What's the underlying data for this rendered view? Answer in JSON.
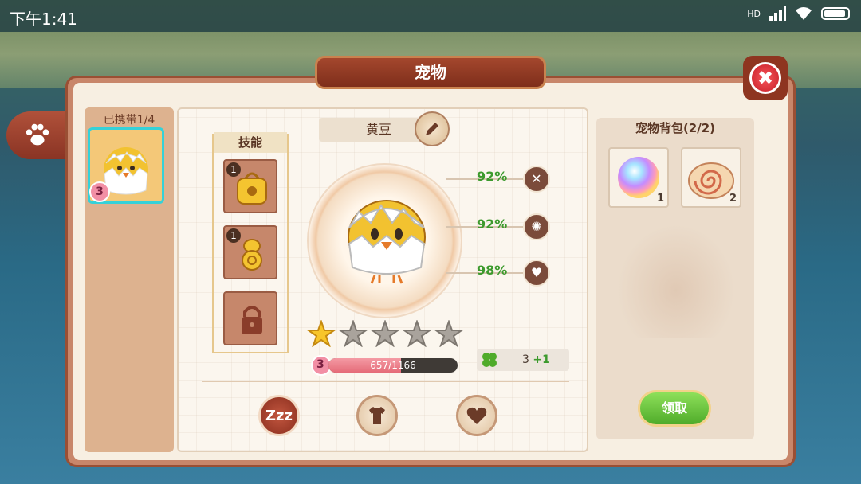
{
  "status": {
    "time": "下午1:41",
    "network": "HD"
  },
  "title": "宠物",
  "carried": {
    "label": "已携带1/4",
    "slots": [
      {
        "level": "3"
      }
    ]
  },
  "skills": {
    "label": "技能",
    "slots": [
      {
        "count": "1",
        "icon": "backpack-icon"
      },
      {
        "count": "1",
        "icon": "mushroom-icon"
      },
      {
        "count": "",
        "icon": "lock-icon"
      }
    ]
  },
  "pet": {
    "name": "黄豆",
    "stats": [
      {
        "value": "92%",
        "icon": "fork-knife-icon"
      },
      {
        "value": "92%",
        "icon": "sparkle-icon"
      },
      {
        "value": "98%",
        "icon": "heart-icon"
      }
    ],
    "stars_filled": 1,
    "stars_total": 5,
    "level": "3",
    "exp_text": "657/1166",
    "exp_fraction": 0.563,
    "clover_count": "3",
    "clover_bonus": "+1"
  },
  "actions": {
    "sleep_label": "Zzz"
  },
  "bag": {
    "title": "宠物背包(2/2)",
    "items": [
      {
        "count": "1",
        "icon": "rainbow-orb-icon"
      },
      {
        "count": "2",
        "icon": "swirl-bun-icon"
      }
    ],
    "collect_label": "领取"
  },
  "colors": {
    "frame": "#9a4f34",
    "accent_green": "#3c9a2d",
    "highlight_cyan": "#35d1d8"
  }
}
